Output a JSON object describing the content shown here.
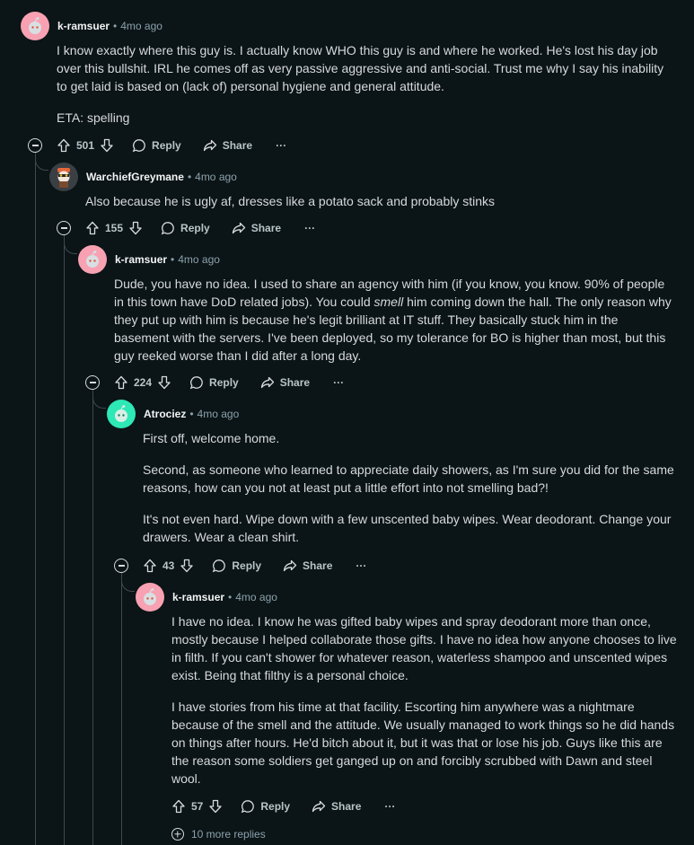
{
  "comments": [
    {
      "author": "k-ramsuer",
      "time": "4mo ago",
      "paragraphs": [
        "I know exactly where this guy is. I actually know WHO this guy is and where he worked. He's lost his day job over this bullshit. IRL he comes off as very passive aggressive and anti-social. Trust me why I say his inability to get laid is based on (lack of) personal hygiene and general attitude.",
        "ETA: spelling"
      ],
      "score": "501",
      "reply_label": "Reply",
      "share_label": "Share",
      "more_label": "···"
    },
    {
      "author": "WarchiefGreymane",
      "time": "4mo ago",
      "paragraphs": [
        "Also because he is ugly af, dresses like a potato sack and probably stinks"
      ],
      "score": "155",
      "reply_label": "Reply",
      "share_label": "Share",
      "more_label": "···"
    },
    {
      "author": "k-ramsuer",
      "time": "4mo ago",
      "paragraph_parts": [
        "Dude, you have no idea. I used to share an agency with him (if you know, you know. 90% of people in this town have DoD related jobs). You could ",
        "smell",
        " him coming down the hall. The only reason why they put up with him is because he's legit brilliant at IT stuff. They basically stuck him in the basement with the servers. I've been deployed, so my tolerance for BO is higher than most, but this guy reeked worse than I did after a long day."
      ],
      "score": "224",
      "reply_label": "Reply",
      "share_label": "Share",
      "more_label": "···"
    },
    {
      "author": "Atrociez",
      "time": "4mo ago",
      "paragraphs": [
        "First off, welcome home.",
        "Second, as someone who learned to appreciate daily showers, as I'm sure you did for the same reasons, how can you not at least put a little effort into not smelling bad?!",
        "It's not even hard. Wipe down with a few unscented baby wipes. Wear deodorant. Change your drawers. Wear a clean shirt."
      ],
      "score": "43",
      "reply_label": "Reply",
      "share_label": "Share",
      "more_label": "···"
    },
    {
      "author": "k-ramsuer",
      "time": "4mo ago",
      "paragraphs": [
        "I have no idea. I know he was gifted baby wipes and spray deodorant more than once, mostly because I helped collaborate those gifts. I have no idea how anyone chooses to live in filth. If you can't shower for whatever reason, waterless shampoo and unscented wipes exist. Being that filthy is a personal choice.",
        "I have stories from his time at that facility. Escorting him anywhere was a nightmare because of the smell and the attitude. We usually managed to work things so he did hands on things after hours. He'd bitch about it, but it was that or lose his job. Guys like this are the reason some soldiers get ganged up on and forcibly scrubbed with Dawn and steel wool."
      ],
      "score": "57",
      "reply_label": "Reply",
      "share_label": "Share",
      "more_label": "···"
    }
  ],
  "more_replies_label": "10 more replies",
  "separator": "•",
  "colors": {
    "background": "#0b1416",
    "text": "#d7dadc",
    "meta": "#8ba2ad",
    "thread_line": "#3e4a4f",
    "avatar_pink": "#f7a1b2",
    "avatar_teal": "#2ee8b6"
  }
}
